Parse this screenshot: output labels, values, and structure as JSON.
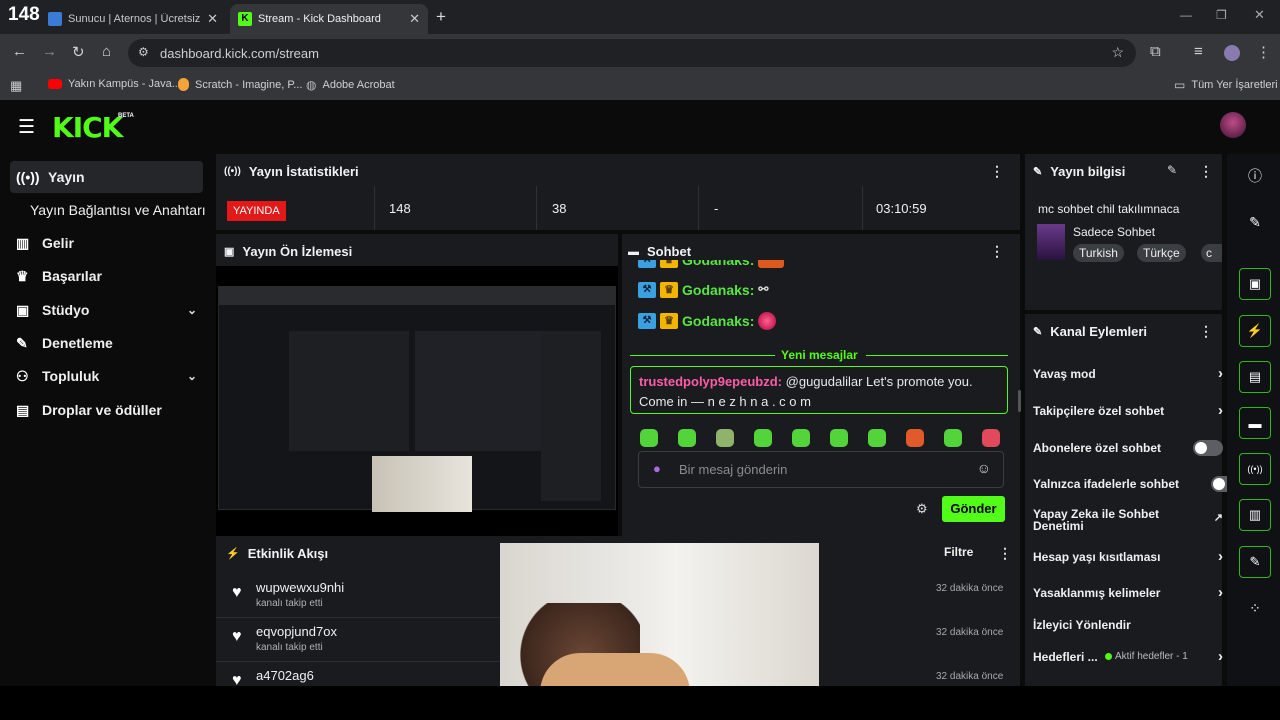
{
  "browser": {
    "counter": "148",
    "tabs": [
      {
        "title": "Sunucu | Aternos | Ücretsiz Min...",
        "active": false
      },
      {
        "title": "Stream - Kick Dashboard",
        "active": true
      }
    ],
    "new_tab": "+",
    "url": "dashboard.kick.com/stream",
    "bookmarks": [
      "Yakın Kampüs - Java...",
      "Scratch - Imagine, P...",
      "Adobe Acrobat"
    ],
    "all_bookmarks": "Tüm Yer İşaretleri"
  },
  "app": {
    "logo": "KICK",
    "logo_badge": "BETA",
    "accent": "#53fc18"
  },
  "sidebar": {
    "items": [
      {
        "label": "Yayın",
        "icon": "broadcast-icon"
      },
      {
        "label": "Yayın Bağlantısı ve Anahtarı",
        "icon": ""
      },
      {
        "label": "Gelir",
        "icon": "revenue-icon"
      },
      {
        "label": "Başarılar",
        "icon": "trophy-icon"
      },
      {
        "label": "Stüdyo",
        "icon": "studio-icon"
      },
      {
        "label": "Denetleme",
        "icon": "wrench-icon"
      },
      {
        "label": "Topluluk",
        "icon": "community-icon"
      },
      {
        "label": "Droplar ve ödüller",
        "icon": "drops-icon"
      }
    ]
  },
  "stats": {
    "title": "Yayın İstatistikleri",
    "live_badge": "YAYINDA",
    "viewers": "148",
    "followers": "38",
    "dash": "-",
    "uptime": "03:10:59"
  },
  "preview": {
    "title": "Yayın Ön İzlemesi"
  },
  "chat": {
    "title": "Sohbet",
    "lines": [
      {
        "user": "Godanaks:"
      },
      {
        "user": "Godanaks:"
      },
      {
        "user": "Godanaks:"
      }
    ],
    "new_messages": "Yeni mesajlar",
    "pinned_user": "trustedpolyp9epeubzd:",
    "pinned_text": "@gugudalilar Let's promote you. Come in — n e z h n a . c o m",
    "input_placeholder": "Bir mesaj gönderin",
    "send": "Gönder"
  },
  "activity": {
    "title": "Etkinlik Akışı",
    "filter": "Filtre",
    "items": [
      {
        "name": "wupwewxu9nhi",
        "sub": "kanalı takip etti",
        "time": "32 dakika önce"
      },
      {
        "name": "eqvopjund7ox",
        "sub": "kanalı takip etti",
        "time": "32 dakika önce"
      },
      {
        "name": "a4702ag6",
        "sub": "",
        "time": "32 dakika önce"
      }
    ]
  },
  "info": {
    "title": "Yayın bilgisi",
    "stream_title": "mc sohbet chil takılımnaca",
    "category": "Sadece Sohbet",
    "tags": [
      "Turkish",
      "Türkçe",
      "c"
    ]
  },
  "channel_actions": {
    "title": "Kanal Eylemleri",
    "items": [
      {
        "label": "Yavaş mod",
        "control": "arrow"
      },
      {
        "label": "Takipçilere özel sohbet",
        "control": "arrow"
      },
      {
        "label": "Abonelere özel sohbet",
        "control": "toggle"
      },
      {
        "label": "Yalnızca ifadelerle sohbet",
        "control": "toggle"
      },
      {
        "label": "Yapay Zeka ile Sohbet Denetimi",
        "control": "external"
      },
      {
        "label": "Hesap yaşı kısıtlaması",
        "control": "arrow"
      },
      {
        "label": "Yasaklanmış kelimeler",
        "control": "arrow"
      },
      {
        "label": "İzleyici Yönlendir",
        "control": "none"
      },
      {
        "label": "Hedefleri ...",
        "control": "arrow",
        "extra": "Aktif hedefler - 1"
      }
    ]
  }
}
